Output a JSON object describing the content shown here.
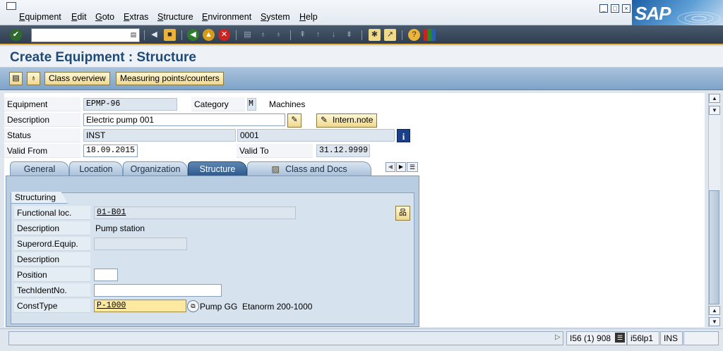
{
  "menubar": {
    "items": [
      {
        "underline": "E",
        "rest": "quipment"
      },
      {
        "underline": "E",
        "rest": "dit"
      },
      {
        "underline": "G",
        "rest": "oto"
      },
      {
        "underline": "E",
        "rest": "xtras"
      },
      {
        "underline": "S",
        "rest": "tructure"
      },
      {
        "underline": "E",
        "rest": "nvironment"
      },
      {
        "underline": "S",
        "rest": "ystem"
      },
      {
        "underline": "H",
        "rest": "elp"
      }
    ],
    "logo_text": "SAP"
  },
  "toolbar": {
    "command_field_value": ""
  },
  "page": {
    "title": "Create Equipment : Structure"
  },
  "app_toolbar": {
    "class_overview": "Class overview",
    "measuring_points": "Measuring points/counters"
  },
  "header": {
    "equipment_label": "Equipment",
    "equipment_value": "EPMP-96",
    "category_label": "Category",
    "category_value": "M",
    "category_text": "Machines",
    "description_label": "Description",
    "description_value": "Electric pump 001",
    "intern_note_label": "Intern.note",
    "status_label": "Status",
    "status_value": "INST",
    "status_value2": "0001",
    "valid_from_label": "Valid From",
    "valid_from_value": "18.09.2015",
    "valid_to_label": "Valid To",
    "valid_to_value": "31.12.9999"
  },
  "tabs": [
    "General",
    "Location",
    "Organization",
    "Structure",
    "Class and Docs"
  ],
  "active_tab": "Structure",
  "structuring": {
    "title": "Structuring",
    "functional_loc_label": "Functional loc.",
    "functional_loc_value": "01-B01",
    "description_label": "Description",
    "description_value": "Pump station",
    "superord_label": "Superord.Equip.",
    "superord_value": "",
    "superord_desc_label": "Description",
    "position_label": "Position",
    "position_value": "",
    "techident_label": "TechIdentNo.",
    "techident_value": "",
    "consttype_label": "ConstType",
    "consttype_value": "P-1000",
    "consttype_text": "Pump GG  Etanorm 200-1000"
  },
  "statusbar": {
    "system_info": "I56 (1) 908",
    "server": "i56lp1",
    "mode": "INS"
  },
  "colors": {
    "title": "#1e4a78",
    "active_tab": "#2f5a8a",
    "toolbar_accent": "#e9b33c",
    "consttype_field": "#fde9a0"
  }
}
